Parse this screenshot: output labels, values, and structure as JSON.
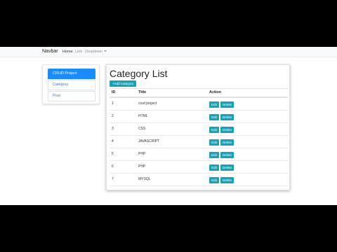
{
  "navbar": {
    "brand": "Navbar",
    "links": [
      "Home",
      "Link",
      "Dropdown"
    ]
  },
  "sidebar": {
    "items": [
      "CRUD Project",
      "Category",
      "Post"
    ],
    "active_index": 0
  },
  "main": {
    "title": "Category List",
    "add_button": "+Add Category",
    "columns": [
      "ID",
      "Title",
      "Action"
    ],
    "rows": [
      {
        "id": "1",
        "title": "crud project"
      },
      {
        "id": "2",
        "title": "HTML"
      },
      {
        "id": "3",
        "title": "CSS"
      },
      {
        "id": "4",
        "title": "JAVASCRIPT"
      },
      {
        "id": "5",
        "title": "PHP"
      },
      {
        "id": "6",
        "title": "PHP"
      },
      {
        "id": "7",
        "title": "MYSQL"
      }
    ],
    "edit_label": "Edit",
    "delete_label": "Delete"
  },
  "colors": {
    "accent": "#17a2b8",
    "primary": "#1a8cff",
    "navbar_bg": "#f8f9fa"
  }
}
